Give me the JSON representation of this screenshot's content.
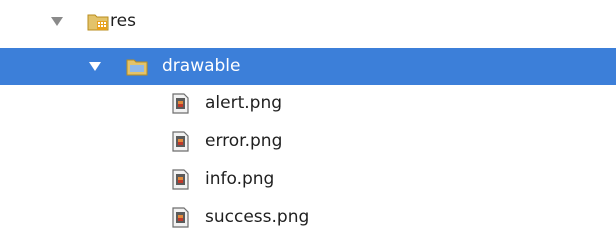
{
  "tree": {
    "root": {
      "label": "res",
      "expanded": true,
      "icon": "resource-folder-icon"
    },
    "folder": {
      "label": "drawable",
      "expanded": true,
      "selected": true,
      "icon": "folder-icon"
    },
    "files": [
      {
        "label": "alert.png",
        "icon": "image-file-icon"
      },
      {
        "label": "error.png",
        "icon": "image-file-icon"
      },
      {
        "label": "info.png",
        "icon": "image-file-icon"
      },
      {
        "label": "success.png",
        "icon": "image-file-icon"
      }
    ]
  },
  "colors": {
    "selection": "#3c7fd9",
    "text": "#1f1f1f",
    "folder": "#d9b44a"
  }
}
